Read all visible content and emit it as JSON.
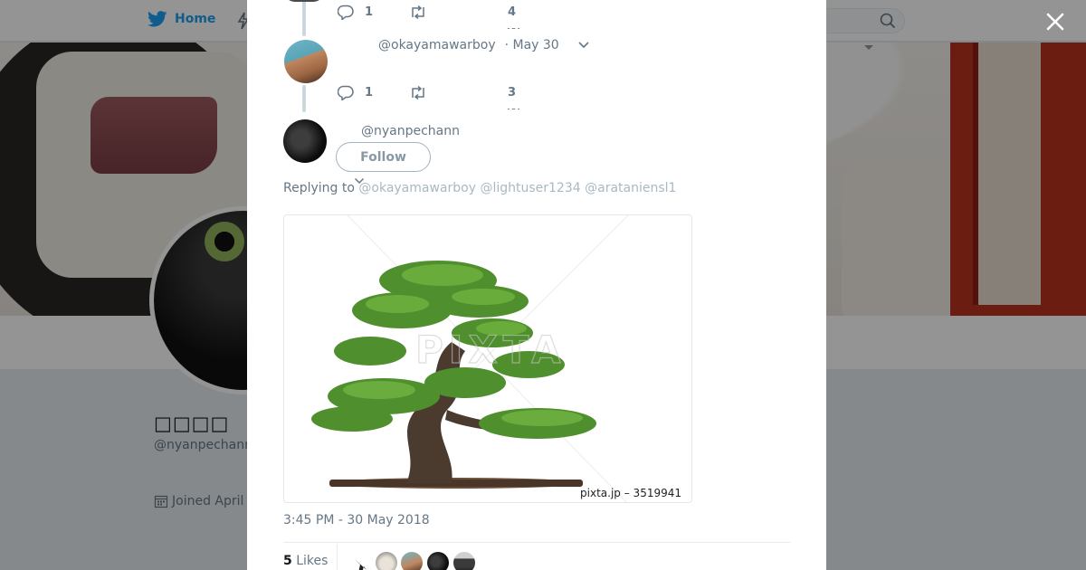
{
  "topbar": {
    "home_label": "Home"
  },
  "profile": {
    "name": "□□□□",
    "handle": "@nyanpechann",
    "joined": "Joined April"
  },
  "thread": {
    "tweet1": {
      "reply_count": "1",
      "like_count": "4"
    },
    "tweet2": {
      "handle": "@okayamawarboy",
      "date": "· May 30",
      "reply_count": "1",
      "like_count": "3"
    }
  },
  "main_tweet": {
    "handle": "@nyanpechann",
    "follow_label": "Follow",
    "replying_prefix": "Replying to",
    "mentions": [
      "@okayamawarboy",
      "@lightuser1234",
      "@arataniensl1"
    ],
    "image_caption": "pixta.jp – 3519941",
    "image_watermark": "PIXTA",
    "timestamp": "3:45 PM - 30 May 2018",
    "likes_count": "5",
    "likes_label": "Likes"
  },
  "colors": {
    "twitter_blue": "#1da1f2",
    "muted_text": "#657786",
    "mention_gray": "#aab8c2"
  },
  "icons": [
    "twitter-bird-icon",
    "lightning-icon",
    "search-icon",
    "close-icon",
    "reply-icon",
    "retweet-icon",
    "heart-icon",
    "chevron-down-icon",
    "calendar-icon"
  ]
}
